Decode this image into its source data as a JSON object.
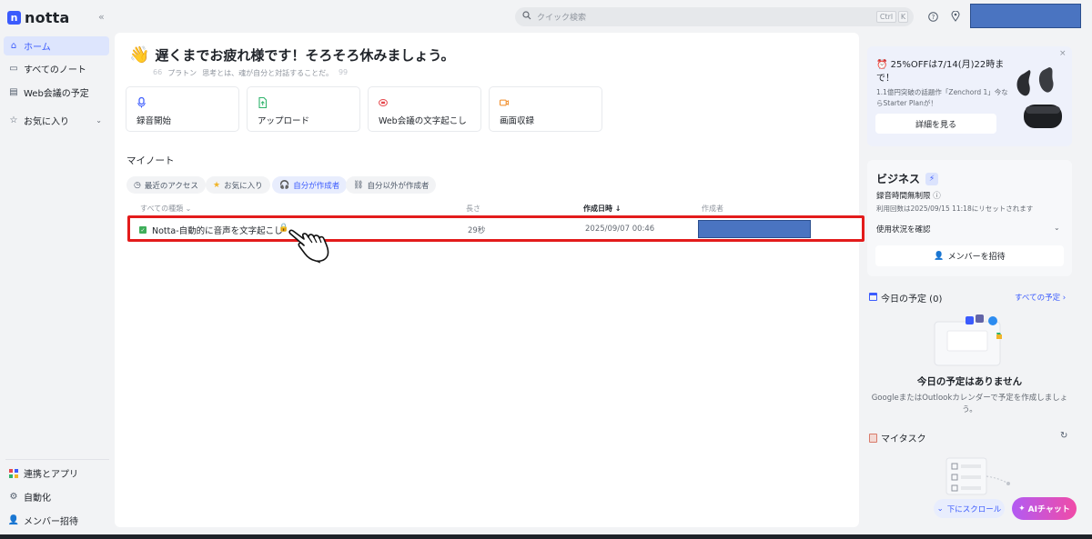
{
  "app": {
    "logo_mark": "n",
    "logo_text": "notta",
    "collapse_icon": "«"
  },
  "sidebar": {
    "items": [
      {
        "label": "ホーム",
        "icon": "home-icon",
        "active": true
      },
      {
        "label": "すべてのノート",
        "icon": "notes-icon"
      },
      {
        "label": "Web会議の予定",
        "icon": "calendar-icon"
      },
      {
        "label": "お気に入り",
        "icon": "star-icon"
      }
    ],
    "bottom_items": [
      {
        "label": "連携とアプリ",
        "icon": "apps-icon"
      },
      {
        "label": "自動化",
        "icon": "automation-icon"
      },
      {
        "label": "メンバー招待",
        "icon": "invite-icon"
      }
    ]
  },
  "topbar": {
    "search_placeholder": "クイック検索",
    "shortcut_ctrl": "Ctrl",
    "shortcut_key": "K"
  },
  "greeting": {
    "emoji": "👋",
    "title": "遅くまでお疲れ様です！そろそろ休みましょう。",
    "quote_author": "プラトン",
    "quote_text": "思考とは、魂が自分と対話することだ。",
    "quote_open": "66",
    "quote_close": "99"
  },
  "actions": [
    {
      "label": "録音開始",
      "icon": "mic-icon",
      "color": "#3b5bfd"
    },
    {
      "label": "アップロード",
      "icon": "upload-icon",
      "color": "#2fb36b"
    },
    {
      "label": "Web会議の文字起こし",
      "icon": "meeting-icon",
      "color": "#e5484d"
    },
    {
      "label": "画面収録",
      "icon": "screen-record-icon",
      "color": "#f08a24"
    }
  ],
  "my_notes": {
    "title": "マイノート",
    "filters": [
      {
        "label": "最近のアクセス",
        "icon": "clock-icon"
      },
      {
        "label": "お気に入り",
        "icon": "star-icon"
      },
      {
        "label": "自分が作成者",
        "icon": "headphone-icon",
        "active": true
      },
      {
        "label": "自分以外が作成者",
        "icon": "link-icon"
      }
    ],
    "columns": {
      "type": "すべての種類",
      "type_caret": "⌄",
      "length": "長さ",
      "created": "作成日時 ↓",
      "owner": "作成者"
    },
    "rows": [
      {
        "title": "Notta-自動的に音声を文字起こし",
        "length": "29秒",
        "created": "2025/09/07 00:46",
        "lock": "🔒"
      }
    ]
  },
  "promo": {
    "title": "25%OFFは7/14(月)22時まで！",
    "desc": "1.1億円突破の話題作「Zenchord 1」今ならStarter Planが！",
    "button": "詳細を見る",
    "close": "×"
  },
  "business": {
    "title": "ビジネス",
    "line1": "録音時間無制限",
    "line2": "利用回数は2025/09/15 11:18にリセットされます",
    "usage": "使用状況を確認",
    "invite": "メンバーを招待"
  },
  "schedule": {
    "title": "今日の予定 (0)",
    "link": "すべての予定 ›",
    "empty_title": "今日の予定はありません",
    "empty_desc": "GoogleまたはOutlookカレンダーで予定を作成しましょう。"
  },
  "tasks": {
    "title": "マイタスク",
    "refresh": "↻"
  },
  "floating": {
    "scroll": "下にスクロール",
    "ai": "AIチャット"
  }
}
